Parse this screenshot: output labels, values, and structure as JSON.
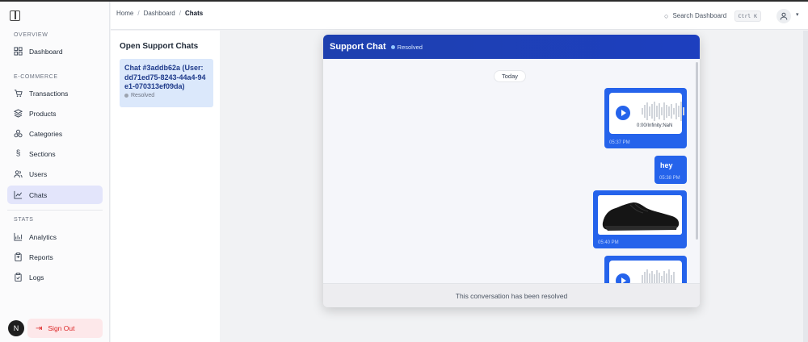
{
  "sidebar": {
    "sections": {
      "overview": "OVERVIEW",
      "ecommerce": "E-COMMERCE",
      "stats": "STATS"
    },
    "items": [
      {
        "label": "Dashboard",
        "icon": "dashboard-icon"
      },
      {
        "label": "Transactions",
        "icon": "cart-icon"
      },
      {
        "label": "Products",
        "icon": "layers-icon"
      },
      {
        "label": "Categories",
        "icon": "shapes-icon"
      },
      {
        "label": "Sections",
        "icon": "section-icon"
      },
      {
        "label": "Users",
        "icon": "users-icon"
      },
      {
        "label": "Chats",
        "icon": "chart-icon",
        "active": true
      },
      {
        "label": "Analytics",
        "icon": "analytics-icon"
      },
      {
        "label": "Reports",
        "icon": "clipboard-icon"
      },
      {
        "label": "Logs",
        "icon": "clipboard-check-icon"
      }
    ],
    "signout": "Sign Out",
    "avatar_letter": "N"
  },
  "header": {
    "breadcrumb": [
      "Home",
      "Dashboard",
      "Chats"
    ],
    "search_placeholder": "Search Dashboard",
    "shortcut": "Ctrl K"
  },
  "chatlist": {
    "title": "Open Support Chats",
    "chats": [
      {
        "title": "Chat #3addb62a (User: dd71ed75-8243-44a4-94e1-070313ef09da)",
        "status": "Resolved"
      }
    ]
  },
  "chat": {
    "title": "Support Chat",
    "status": "Resolved",
    "day_label": "Today",
    "messages": [
      {
        "type": "audio",
        "duration": "0:00/Infinity:NaN",
        "time": "05:37 PM"
      },
      {
        "type": "text",
        "text": "hey",
        "time": "05:38 PM"
      },
      {
        "type": "image",
        "alt": "black running shoe",
        "time": "05:40 PM"
      },
      {
        "type": "audio",
        "duration": "",
        "time": ""
      }
    ],
    "footer": "This conversation has been resolved"
  },
  "colors": {
    "accent": "#2563eb",
    "header_blue": "#1e40af",
    "signout_red": "#dc2626",
    "active_bg": "#e3e5fb"
  }
}
